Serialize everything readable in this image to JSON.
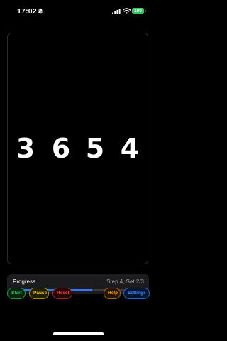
{
  "status_bar": {
    "time": "17:02",
    "bell_icon": "bell-slash-icon",
    "signal_icon": "cellular-signal-icon",
    "wifi_icon": "wifi-icon",
    "battery_level": "100",
    "battery_color": "#33c759"
  },
  "display": {
    "digits": [
      "3",
      "6",
      "5",
      "4"
    ]
  },
  "progress": {
    "label": "Progress",
    "status": "Step 4, Set 2/3",
    "fraction": 0.6,
    "fill_color": "#3478f6"
  },
  "controls": {
    "start_label": "Start",
    "pause_label": "Pause",
    "reset_label": "Reset",
    "help_label": "Help",
    "settings_label": "Settings",
    "colors": {
      "start": "#34c759",
      "pause": "#ffd60a",
      "reset": "#ff453a",
      "help": "#ff9f0a",
      "settings": "#3a8cff"
    }
  }
}
